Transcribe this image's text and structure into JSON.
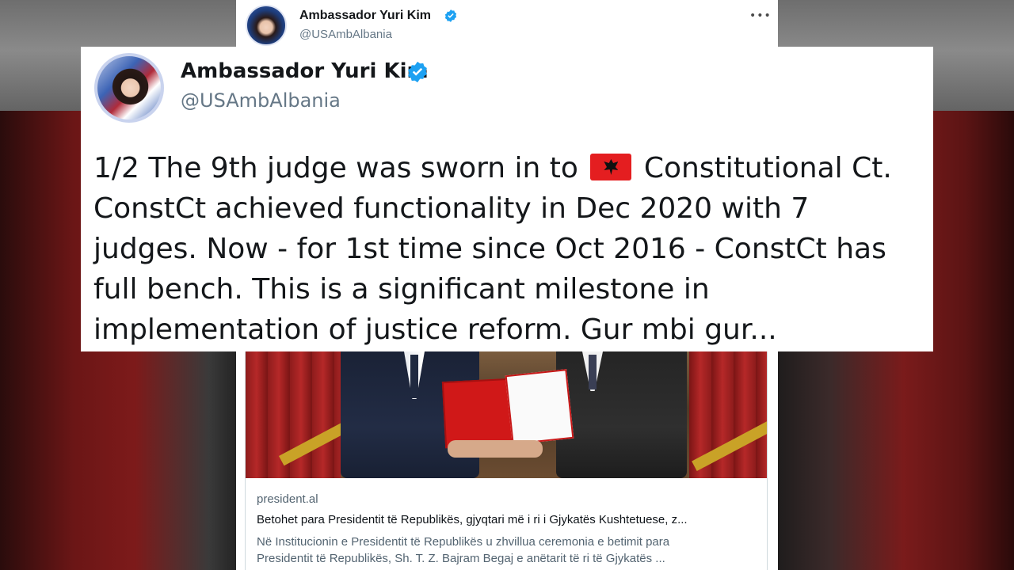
{
  "tweet": {
    "author_name": "Ambassador Yuri Kim",
    "author_handle": "@USAmbAlbania",
    "more_icon": "more-horizontal-icon",
    "verified_icon": "verified-badge-icon",
    "verified_color": "#1da1f2",
    "text_lines": [
      {
        "before": "1/2 The 9th judge was sworn in to",
        "flag": "albania-flag-icon",
        "after": "Constitutional Ct."
      },
      {
        "text": "ConstCt achieved functionality in Dec 2020 with 7"
      },
      {
        "text": "judges. Now - for 1st time since Oct 2016 - ConstCt has"
      },
      {
        "text": "full bench. This is a significant milestone in"
      },
      {
        "text": "implementation of justice reform. Gur mbi gur..."
      }
    ]
  },
  "link_card": {
    "domain": "president.al",
    "title": "Betohet para Presidentit të Republikës, gjyqtari më i ri i Gjykatës Kushtetuese, z...",
    "description_line1": "Në Institucionin e Presidentit të Republikës u zhvillua ceremonia e betimit para",
    "description_line2": "Presidentit të Republikës, Sh. T.  Z. Bajram Begaj e anëtarit të ri të Gjykatës ..."
  },
  "colors": {
    "flag_red": "#e41e20",
    "text_primary": "#14171a",
    "text_secondary": "#657786"
  }
}
